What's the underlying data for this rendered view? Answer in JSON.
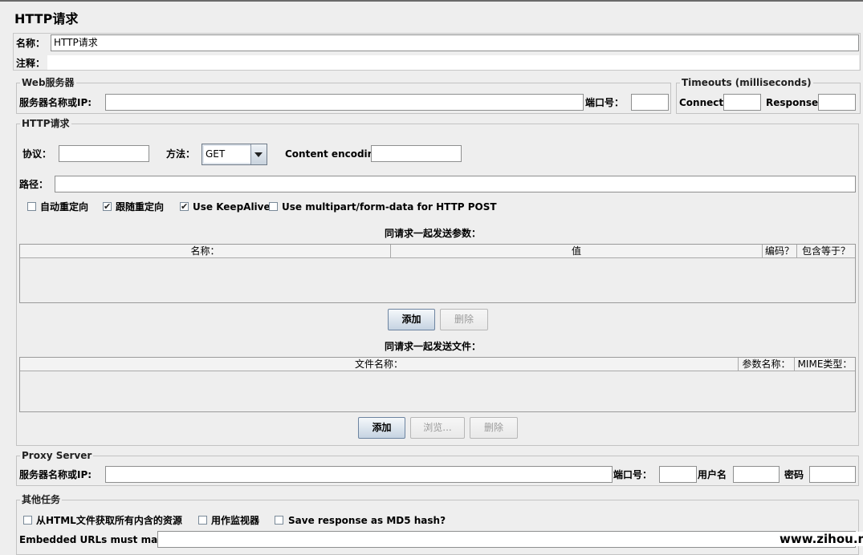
{
  "page_title": "HTTP请求",
  "name_label": "名称：",
  "name_value": "HTTP请求",
  "comment_label": "注释：",
  "comment_value": "",
  "web_server": {
    "legend": "Web服务器",
    "server_label": "服务器名称或IP:",
    "server_value": "",
    "port_label": "端口号：",
    "port_value": ""
  },
  "timeouts": {
    "legend": "Timeouts (milliseconds)",
    "connect_label": "Connect:",
    "connect_value": "",
    "response_label": "Response:",
    "response_value": ""
  },
  "http_request": {
    "legend": "HTTP请求",
    "protocol_label": "协议：",
    "protocol_value": "",
    "method_label": "方法：",
    "method_value": "GET",
    "encoding_label": "Content encoding:",
    "encoding_value": "",
    "path_label": "路径：",
    "path_value": "",
    "checkboxes": [
      {
        "label": "自动重定向",
        "checked": false
      },
      {
        "label": "跟随重定向",
        "checked": true
      },
      {
        "label": "Use KeepAlive",
        "checked": true
      },
      {
        "label": "Use multipart/form-data for HTTP POST",
        "checked": false
      }
    ],
    "params_title": "同请求一起发送参数：",
    "params_columns": [
      "名称：",
      "值",
      "编码？",
      "包含等于？"
    ],
    "params_add": "添加",
    "params_delete": "删除",
    "files_title": "同请求一起发送文件：",
    "files_columns": [
      "文件名称：",
      "参数名称：",
      "MIME类型："
    ],
    "files_add": "添加",
    "files_browse": "浏览...",
    "files_delete": "删除"
  },
  "proxy": {
    "legend": "Proxy Server",
    "server_label": "服务器名称或IP:",
    "server_value": "",
    "port_label": "端口号：",
    "port_value": "",
    "user_label": "用户名",
    "user_value": "",
    "password_label": "密码",
    "password_value": ""
  },
  "other_tasks": {
    "legend": "其他任务",
    "checkboxes": [
      {
        "label": "从HTML文件获取所有内含的资源",
        "checked": false
      },
      {
        "label": "用作监视器",
        "checked": false
      },
      {
        "label": "Save response as MD5 hash?",
        "checked": false
      }
    ],
    "embedded_label": "Embedded URLs must match:",
    "embedded_value": ""
  },
  "watermark": "www.zihou.me"
}
